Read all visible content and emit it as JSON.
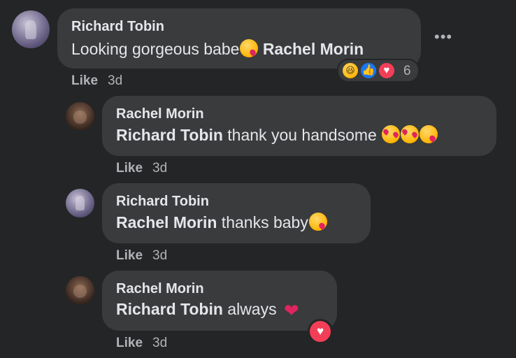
{
  "comments": [
    {
      "author": "Richard Tobin",
      "text": "Looking gorgeous babe",
      "mention": "Rachel Morin",
      "like_label": "Like",
      "time": "3d",
      "reaction_count": "6"
    },
    {
      "author": "Rachel Morin",
      "mention": "Richard Tobin",
      "text": " thank you handsome ",
      "like_label": "Like",
      "time": "3d"
    },
    {
      "author": "Richard Tobin",
      "mention": "Rachel Morin",
      "text": " thanks baby",
      "like_label": "Like",
      "time": "3d"
    },
    {
      "author": "Rachel Morin",
      "mention": "Richard Tobin",
      "text": " always ",
      "like_label": "Like",
      "time": "3d"
    }
  ],
  "icons": {
    "more": "more-options-icon",
    "reactions": [
      "haha-icon",
      "like-icon",
      "love-icon"
    ],
    "emoji_kiss": "face-blowing-kiss-emoji",
    "emoji_hearts": "smiling-face-with-hearts-emoji",
    "heart": "red-heart-emoji"
  },
  "colors": {
    "background": "#242526",
    "bubble": "#3a3b3c",
    "text": "#e4e6eb",
    "secondary": "#b0b3b8",
    "like_blue": "#1877f2",
    "love_red": "#f33e58"
  }
}
